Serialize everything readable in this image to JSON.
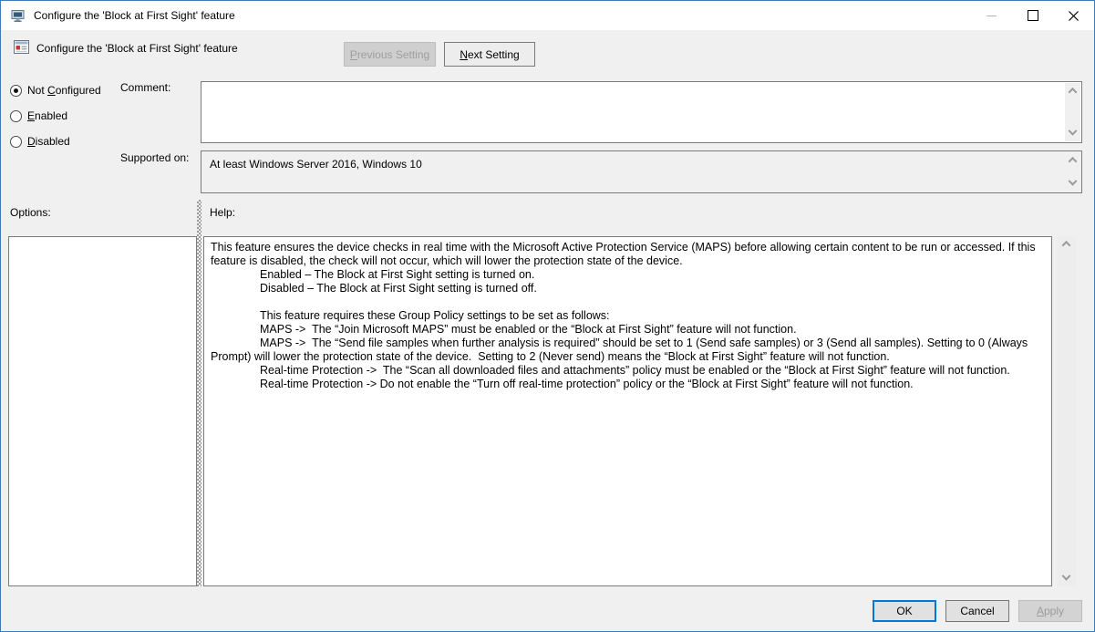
{
  "window": {
    "title": "Configure the 'Block at First Sight' feature"
  },
  "header": {
    "title": "Configure the 'Block at First Sight' feature",
    "previous_button": {
      "pre": "",
      "key": "P",
      "post": "revious Setting"
    },
    "next_button": {
      "pre": "",
      "key": "N",
      "post": "ext Setting"
    }
  },
  "radios": [
    {
      "pre": "Not ",
      "key": "C",
      "post": "onfigured",
      "selected": true
    },
    {
      "pre": "",
      "key": "E",
      "post": "nabled",
      "selected": false
    },
    {
      "pre": "",
      "key": "D",
      "post": "isabled",
      "selected": false
    }
  ],
  "comment": {
    "label": "Comment:",
    "value": ""
  },
  "supported": {
    "label": "Supported on:",
    "value": "At least Windows Server 2016, Windows 10"
  },
  "options": {
    "label": "Options:"
  },
  "help": {
    "label": "Help:",
    "paragraphs": [
      {
        "indent": false,
        "text": "This feature ensures the device checks in real time with the Microsoft Active Protection Service (MAPS) before allowing certain content to be run or accessed. If this feature is disabled, the check will not occur, which will lower the protection state of the device."
      },
      {
        "indent": true,
        "text": "Enabled – The Block at First Sight setting is turned on."
      },
      {
        "indent": true,
        "text": "Disabled – The Block at First Sight setting is turned off."
      },
      {
        "indent": false,
        "text": ""
      },
      {
        "indent": true,
        "text": "This feature requires these Group Policy settings to be set as follows:"
      },
      {
        "indent": true,
        "text": "MAPS ->  The “Join Microsoft MAPS” must be enabled or the “Block at First Sight” feature will not function."
      },
      {
        "indent": true,
        "text": "MAPS ->  The “Send file samples when further analysis is required” should be set to 1 (Send safe samples) or 3 (Send all samples). Setting to 0 (Always Prompt) will lower the protection state of the device.  Setting to 2 (Never send) means the “Block at First Sight” feature will not function."
      },
      {
        "indent": true,
        "text": "Real-time Protection ->  The “Scan all downloaded files and attachments” policy must be enabled or the “Block at First Sight” feature will not function."
      },
      {
        "indent": true,
        "text": "Real-time Protection -> Do not enable the “Turn off real-time protection” policy or the “Block at First Sight” feature will not function."
      }
    ]
  },
  "footer": {
    "ok": "OK",
    "cancel": "Cancel",
    "apply": {
      "pre": "",
      "key": "A",
      "post": "pply"
    }
  },
  "colors": {
    "accent": "#0078d7",
    "window_border": "#3e7cb9",
    "dialog_bg": "#f0f0f0",
    "titlebar_bg": "#ffffff"
  }
}
